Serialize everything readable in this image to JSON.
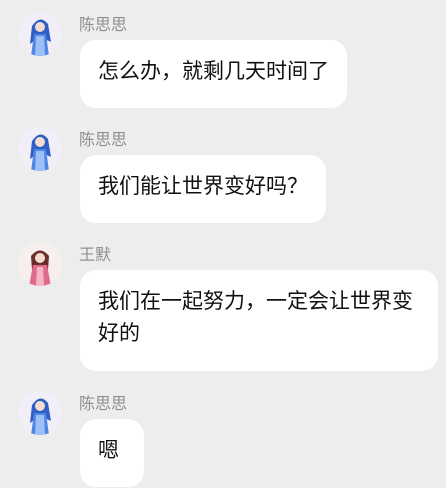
{
  "messages": [
    {
      "sender": "陈思思",
      "text": "怎么办，就剩几天时间了",
      "avatar_icon": "blue-anime-character-avatar"
    },
    {
      "sender": "陈思思",
      "text": "我们能让世界变好吗？",
      "avatar_icon": "blue-anime-character-avatar"
    },
    {
      "sender": "王默",
      "text": "我们在一起努力，一定会让世界变好的",
      "avatar_icon": "pink-anime-character-avatar"
    },
    {
      "sender": "陈思思",
      "text": "嗯",
      "avatar_icon": "blue-anime-character-avatar"
    }
  ],
  "colors": {
    "background": "#ededed",
    "bubble": "#ffffff",
    "name_text": "#8f8f8f",
    "message_text": "#111111"
  }
}
